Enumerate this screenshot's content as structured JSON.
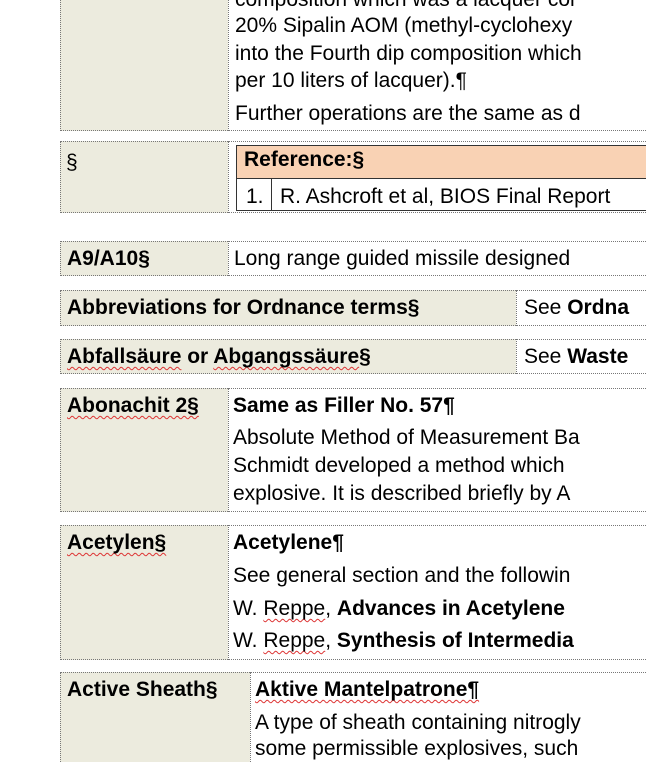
{
  "top": {
    "lines": [
      "composition which was a lacquer cor",
      "20% Sipalin AOM (methyl-cyclohexy",
      "into the Fourth dip composition which",
      "per 10 liters of lacquer).¶",
      "Further operations are the same as d"
    ]
  },
  "references": {
    "term": "§",
    "header": "Reference:§",
    "items": [
      {
        "num": "1.",
        "text": "R. Ashcroft et al, BIOS Final Report"
      }
    ]
  },
  "entries": {
    "a9": {
      "term": "A9/A10§",
      "text": "Long range guided missile designed"
    },
    "abbr": {
      "term": "Abbreviations for Ordnance terms§",
      "see": "See ",
      "ref": "Ordna"
    },
    "abfall": {
      "term_a": "Abfallsäure",
      "term_b": " or ",
      "term_c": "Abgangssäure",
      "term_d": "§",
      "see": "See ",
      "ref": "Waste"
    },
    "abon": {
      "term": "Abonachit 2§",
      "title": "Same as Filler No. 57¶",
      "lines": [
        "Absolute Method of Measurement Ba",
        "Schmidt developed a method which",
        "explosive. It is described briefly by A"
      ]
    },
    "acet": {
      "term": "Acetylen§",
      "title": "Acetylene¶",
      "line1": "See general section and the followin",
      "line2_a": "W. ",
      "line2_b": "Reppe",
      "line2_c": ", ",
      "line2_d": "Advances in Acetylene",
      "line3_a": "W. ",
      "line3_b": "Reppe",
      "line3_c": ", ",
      "line3_d": "Synthesis of Intermedia"
    },
    "sheath": {
      "term": "Active Sheath§",
      "title": "Aktive Mantelpatrone¶",
      "lines": [
        "A type of sheath containing nitrogly",
        "some permissible explosives, such"
      ]
    }
  }
}
